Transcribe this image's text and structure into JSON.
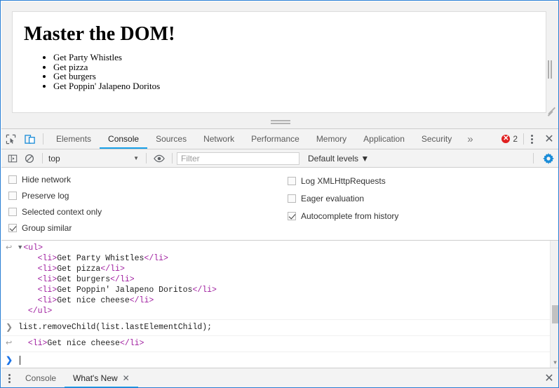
{
  "page": {
    "heading": "Master the DOM!",
    "list_items": [
      "Get Party Whistles",
      "Get pizza",
      "Get burgers",
      "Get Poppin' Jalapeno Doritos"
    ]
  },
  "devtools": {
    "tabs": [
      {
        "label": "Elements",
        "active": false
      },
      {
        "label": "Console",
        "active": true
      },
      {
        "label": "Sources",
        "active": false
      },
      {
        "label": "Network",
        "active": false
      },
      {
        "label": "Performance",
        "active": false
      },
      {
        "label": "Memory",
        "active": false
      },
      {
        "label": "Application",
        "active": false
      },
      {
        "label": "Security",
        "active": false
      }
    ],
    "more_tabs_label": "»",
    "error_count": "2",
    "icons": {
      "inspect": "inspect-element-icon",
      "device": "device-toolbar-icon",
      "kebab": "more-options-icon",
      "close": "close-devtools-icon"
    },
    "accent_color": "#18a0e8",
    "error_color": "#e02020"
  },
  "console_toolbar": {
    "sidebar_toggle": "console-sidebar-icon",
    "clear_label": "clear-console-icon",
    "context": "top",
    "context_caret": "▼",
    "live_expression": "eye-icon",
    "filter_placeholder": "Filter",
    "filter_value": "",
    "levels": "Default levels ▼",
    "settings": "gear-icon"
  },
  "settings": {
    "left": [
      {
        "label": "Hide network",
        "checked": false
      },
      {
        "label": "Preserve log",
        "checked": false
      },
      {
        "label": "Selected context only",
        "checked": false
      },
      {
        "label": "Group similar",
        "checked": true
      }
    ],
    "right": [
      {
        "label": "Log XMLHttpRequests",
        "checked": false
      },
      {
        "label": "Eager evaluation",
        "checked": false
      },
      {
        "label": "Autocomplete from history",
        "checked": true
      }
    ]
  },
  "console_log": {
    "result_arrow": "↩",
    "prompt_arrow": "❯",
    "expand_triangle": "▼",
    "entry1": {
      "open_tag": "<ul>",
      "children": [
        {
          "open": "<li>",
          "text": "Get Party Whistles",
          "close": "</li>"
        },
        {
          "open": "<li>",
          "text": "Get pizza",
          "close": "</li>"
        },
        {
          "open": "<li>",
          "text": "Get burgers",
          "close": "</li>"
        },
        {
          "open": "<li>",
          "text": "Get Poppin' Jalapeno Doritos",
          "close": "</li>"
        },
        {
          "open": "<li>",
          "text": "Get nice cheese",
          "close": "</li>"
        }
      ],
      "close_tag": "</ul>"
    },
    "command": "list.removeChild(list.lastElementChild);",
    "entry2": {
      "open": "<li>",
      "text": "Get nice cheese",
      "close": "</li>"
    },
    "input_value": ""
  },
  "drawer": {
    "menu_icon": "drawer-menu-icon",
    "tabs": [
      {
        "label": "Console",
        "active": false,
        "closable": false
      },
      {
        "label": "What's New",
        "active": true,
        "closable": true
      }
    ],
    "close_label": "✕"
  }
}
